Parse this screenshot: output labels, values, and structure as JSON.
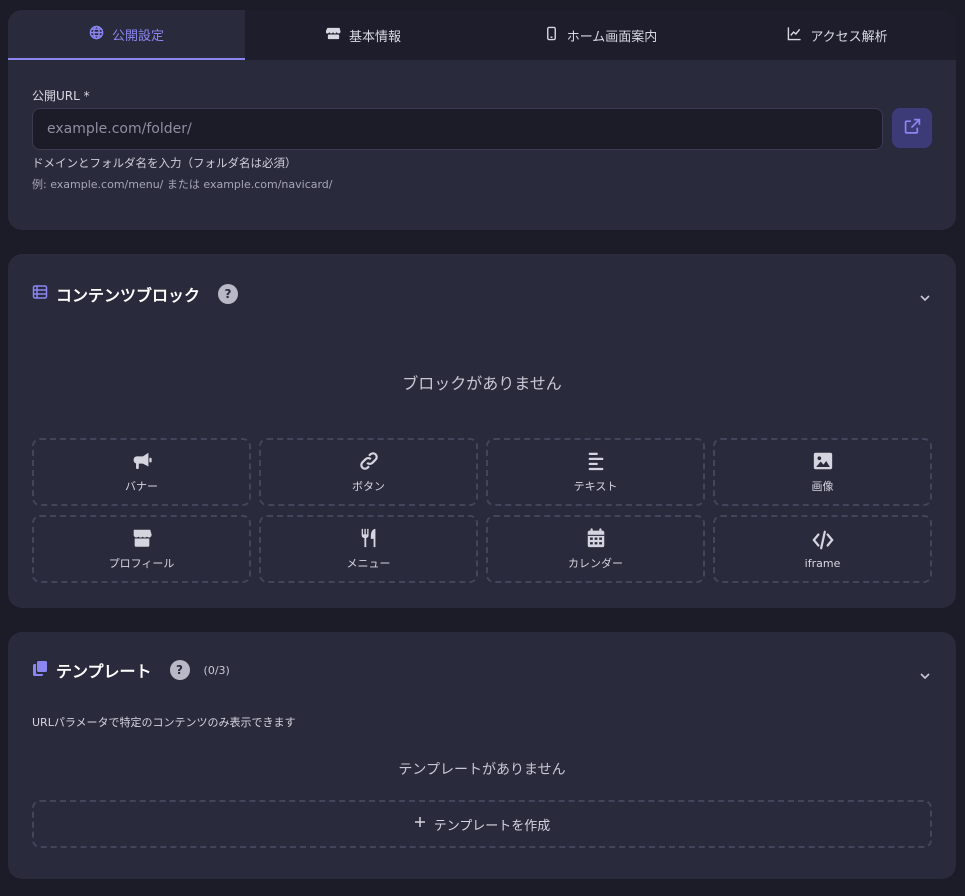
{
  "tabs": [
    {
      "label": "公開設定",
      "icon": "globe-icon",
      "active": true
    },
    {
      "label": "基本情報",
      "icon": "store-icon",
      "active": false
    },
    {
      "label": "ホーム画面案内",
      "icon": "mobile-icon",
      "active": false
    },
    {
      "label": "アクセス解析",
      "icon": "chart-line-icon",
      "active": false
    }
  ],
  "public": {
    "url_label": "公開URL *",
    "url_placeholder": "example.com/folder/",
    "help": "ドメインとフォルダ名を入力（フォルダ名は必須）",
    "example": "例: example.com/menu/ または example.com/navicard/"
  },
  "blocks": {
    "title": "コンテンツブロック",
    "help": "?",
    "empty": "ブロックがありません",
    "items": [
      {
        "label": "バナー",
        "icon": "megaphone-icon"
      },
      {
        "label": "ボタン",
        "icon": "link-icon"
      },
      {
        "label": "テキスト",
        "icon": "align-left-icon"
      },
      {
        "label": "画像",
        "icon": "image-icon"
      },
      {
        "label": "プロフィール",
        "icon": "store-icon"
      },
      {
        "label": "メニュー",
        "icon": "utensils-icon"
      },
      {
        "label": "カレンダー",
        "icon": "calendar-icon"
      },
      {
        "label": "iframe",
        "icon": "code-icon"
      }
    ]
  },
  "templates": {
    "title": "テンプレート",
    "help": "?",
    "count": "(0/3)",
    "description": "URLパラメータで特定のコンテンツのみ表示できます",
    "empty": "テンプレートがありません",
    "create_label": "テンプレートを作成"
  },
  "colors": {
    "background": "#1c1b28",
    "card": "#2a2a3d",
    "accent": "#8b86f0",
    "button_bg": "#3d3a78"
  }
}
